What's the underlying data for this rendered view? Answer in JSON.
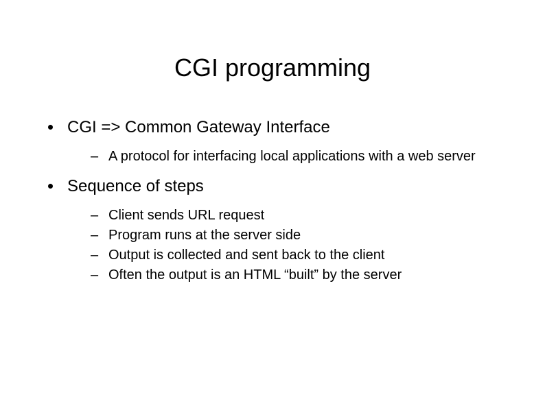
{
  "title": "CGI programming",
  "items": [
    {
      "text": "CGI => Common Gateway Interface",
      "sub": [
        "A protocol for interfacing local applications with a web server"
      ]
    },
    {
      "text": "Sequence of steps",
      "sub": [
        "Client sends URL request",
        "Program runs at the server side",
        "Output is collected and sent back to the client",
        "Often the output is an HTML “built” by the server"
      ]
    }
  ]
}
